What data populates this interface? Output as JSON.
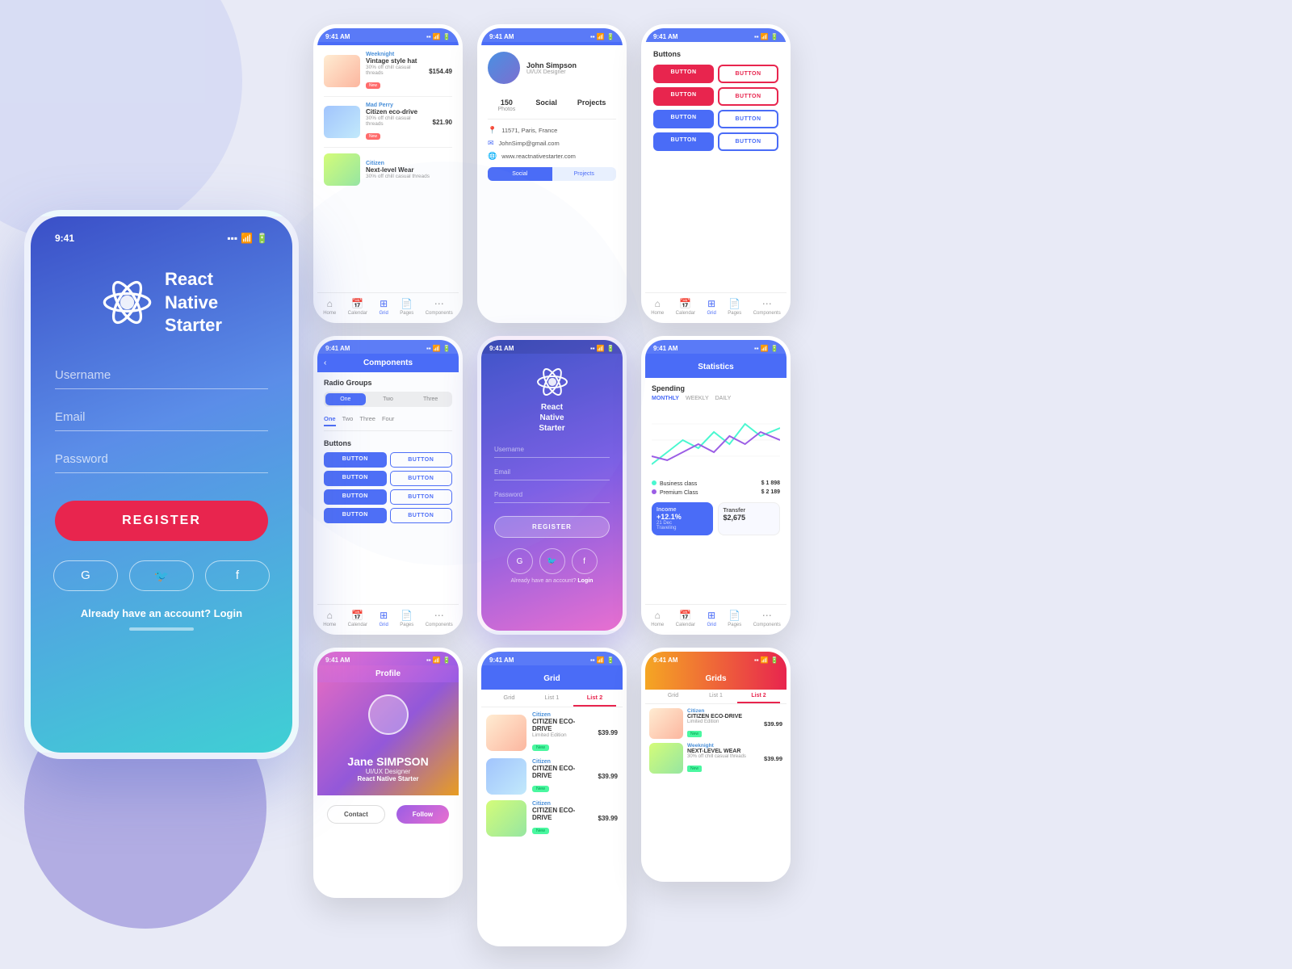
{
  "app": {
    "name": "React Native Starter",
    "tagline": "React Native Starter"
  },
  "main_phone": {
    "status_time": "9:41",
    "username_placeholder": "Username",
    "email_placeholder": "Email",
    "password_placeholder": "Password",
    "register_label": "REGISTER",
    "already_account": "Already have an account?",
    "login_label": "Login"
  },
  "shop_phone": {
    "status_time": "9:41 AM",
    "items": [
      {
        "brand": "Weeknight",
        "title": "Vintage style hat",
        "subtitle": "30% off chill casual threads",
        "badge": "New",
        "price": "$154.49"
      },
      {
        "brand": "Mad Perry",
        "title": "Citizen eco-drive",
        "subtitle": "30% off chill casual threads",
        "badge": "New",
        "price": "$21.90"
      },
      {
        "brand": "Citizen",
        "title": "Next-level Wear",
        "subtitle": "30% off chill casual threads",
        "badge": null,
        "price": ""
      }
    ],
    "nav": [
      "Home",
      "Calendar",
      "Grid",
      "Pages",
      "Components"
    ]
  },
  "user_info_phone": {
    "status_time": "9:41 AM",
    "location": "11571, Paris, France",
    "email": "JohnSimp@gmail.com",
    "website": "www.reactnativestarter.com",
    "stats": [
      {
        "num": "150",
        "label": "Photos"
      },
      {
        "num": "Social",
        "label": ""
      },
      {
        "num": "Projects",
        "label": ""
      }
    ]
  },
  "components_phone": {
    "status_time": "9:41 AM",
    "title": "Components",
    "radio_groups_label": "Radio Groups",
    "radio_group_1": [
      "One",
      "Two",
      "Three"
    ],
    "radio_group_2": [
      "One",
      "Two",
      "Three",
      "Four"
    ],
    "buttons_label": "Buttons",
    "buttons": [
      [
        "BUTTON",
        "BUTTON"
      ],
      [
        "BUTTON",
        "BUTTON"
      ],
      [
        "BUTTON",
        "BUTTON"
      ],
      [
        "BUTTON",
        "BUTTON"
      ]
    ],
    "nav": [
      "Home",
      "Calendar",
      "Grid",
      "Pages",
      "Components"
    ]
  },
  "register_phone": {
    "status_time": "9:41 AM",
    "logo_text": "React\nNative\nStarter",
    "username": "Username",
    "email": "Email",
    "password": "Password",
    "register_btn": "REGISTER",
    "already": "Already have an account?",
    "login": "Login"
  },
  "buttons_phone": {
    "status_time": "9:41 AM",
    "title": "Buttons",
    "buttons": [
      [
        "BUTTON",
        "BUTTON"
      ],
      [
        "BUTTON",
        "BUTTON"
      ],
      [
        "BUTTON",
        "BUTTON"
      ],
      [
        "BUTTON",
        "BUTTON"
      ]
    ],
    "nav": [
      "Home",
      "Calendar",
      "Grid",
      "Pages",
      "Components"
    ]
  },
  "stats_phone": {
    "status_time": "9:41 AM",
    "title": "Statistics",
    "spending_label": "Spending",
    "time_tabs": [
      "MONTHLY",
      "WEEKLY",
      "DAILY"
    ],
    "legend": [
      {
        "name": "Business class",
        "color": "#4af7d0",
        "value": "$ 1 898"
      },
      {
        "name": "Premium Class",
        "color": "#9b5de5",
        "value": "$ 2 189"
      }
    ],
    "income_label": "Income",
    "income_change": "+12.1%",
    "income_date": "21 Dec",
    "income_type": "Traveling",
    "transfer_label": "Transfer",
    "transfer_amount": "$2,675"
  },
  "grid_phone": {
    "status_time": "9:41 AM",
    "title": "Grid",
    "tabs": [
      "Grid",
      "List 1",
      "List 2"
    ],
    "items": [
      {
        "brand": "Citizen",
        "name": "CITIZEN ECO-DRIVE",
        "edition": "Limited Edition",
        "badge": "New",
        "price": "$39.99"
      },
      {
        "brand": "Citizen",
        "name": "CITIZEN ECO-DRIVE",
        "edition": "",
        "badge": "New",
        "price": "$39.99"
      },
      {
        "brand": "Citizen",
        "name": "CITIZEN ECO-DRIVE",
        "edition": "",
        "badge": "New",
        "price": "$39.99"
      }
    ]
  },
  "profile_phone": {
    "status_time": "9:41 AM",
    "name": "Jane SIMPSON",
    "role": "UI/UX Designer",
    "company": "React Native Starter",
    "contact_btn": "Contact",
    "follow_btn": "Follow"
  },
  "grids_phone": {
    "status_time": "9:41 AM",
    "title": "Grids",
    "tabs": [
      "Grid",
      "List 1",
      "List 2"
    ],
    "items": [
      {
        "brand": "Citizen",
        "name": "CITIZEN ECO-DRIVE",
        "edition": "Limited Edition",
        "badge": "New",
        "price": "$39.99"
      },
      {
        "brand": "Weeknight",
        "name": "NEXT-LEVEL WEAR",
        "edition": "30% off chill casual threads",
        "badge": "New",
        "price": "$39.99"
      }
    ]
  }
}
